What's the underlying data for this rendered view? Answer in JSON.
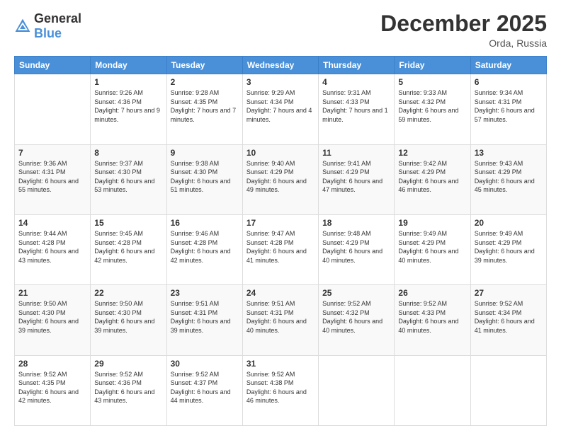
{
  "header": {
    "logo_general": "General",
    "logo_blue": "Blue",
    "month": "December 2025",
    "location": "Orda, Russia"
  },
  "weekdays": [
    "Sunday",
    "Monday",
    "Tuesday",
    "Wednesday",
    "Thursday",
    "Friday",
    "Saturday"
  ],
  "weeks": [
    [
      {
        "date": "",
        "sunrise": "",
        "sunset": "",
        "daylight": ""
      },
      {
        "date": "1",
        "sunrise": "9:26 AM",
        "sunset": "4:36 PM",
        "daylight": "7 hours and 9 minutes."
      },
      {
        "date": "2",
        "sunrise": "9:28 AM",
        "sunset": "4:35 PM",
        "daylight": "7 hours and 7 minutes."
      },
      {
        "date": "3",
        "sunrise": "9:29 AM",
        "sunset": "4:34 PM",
        "daylight": "7 hours and 4 minutes."
      },
      {
        "date": "4",
        "sunrise": "9:31 AM",
        "sunset": "4:33 PM",
        "daylight": "7 hours and 1 minute."
      },
      {
        "date": "5",
        "sunrise": "9:33 AM",
        "sunset": "4:32 PM",
        "daylight": "6 hours and 59 minutes."
      },
      {
        "date": "6",
        "sunrise": "9:34 AM",
        "sunset": "4:31 PM",
        "daylight": "6 hours and 57 minutes."
      }
    ],
    [
      {
        "date": "7",
        "sunrise": "9:36 AM",
        "sunset": "4:31 PM",
        "daylight": "6 hours and 55 minutes."
      },
      {
        "date": "8",
        "sunrise": "9:37 AM",
        "sunset": "4:30 PM",
        "daylight": "6 hours and 53 minutes."
      },
      {
        "date": "9",
        "sunrise": "9:38 AM",
        "sunset": "4:30 PM",
        "daylight": "6 hours and 51 minutes."
      },
      {
        "date": "10",
        "sunrise": "9:40 AM",
        "sunset": "4:29 PM",
        "daylight": "6 hours and 49 minutes."
      },
      {
        "date": "11",
        "sunrise": "9:41 AM",
        "sunset": "4:29 PM",
        "daylight": "6 hours and 47 minutes."
      },
      {
        "date": "12",
        "sunrise": "9:42 AM",
        "sunset": "4:29 PM",
        "daylight": "6 hours and 46 minutes."
      },
      {
        "date": "13",
        "sunrise": "9:43 AM",
        "sunset": "4:29 PM",
        "daylight": "6 hours and 45 minutes."
      }
    ],
    [
      {
        "date": "14",
        "sunrise": "9:44 AM",
        "sunset": "4:28 PM",
        "daylight": "6 hours and 43 minutes."
      },
      {
        "date": "15",
        "sunrise": "9:45 AM",
        "sunset": "4:28 PM",
        "daylight": "6 hours and 42 minutes."
      },
      {
        "date": "16",
        "sunrise": "9:46 AM",
        "sunset": "4:28 PM",
        "daylight": "6 hours and 42 minutes."
      },
      {
        "date": "17",
        "sunrise": "9:47 AM",
        "sunset": "4:28 PM",
        "daylight": "6 hours and 41 minutes."
      },
      {
        "date": "18",
        "sunrise": "9:48 AM",
        "sunset": "4:29 PM",
        "daylight": "6 hours and 40 minutes."
      },
      {
        "date": "19",
        "sunrise": "9:49 AM",
        "sunset": "4:29 PM",
        "daylight": "6 hours and 40 minutes."
      },
      {
        "date": "20",
        "sunrise": "9:49 AM",
        "sunset": "4:29 PM",
        "daylight": "6 hours and 39 minutes."
      }
    ],
    [
      {
        "date": "21",
        "sunrise": "9:50 AM",
        "sunset": "4:30 PM",
        "daylight": "6 hours and 39 minutes."
      },
      {
        "date": "22",
        "sunrise": "9:50 AM",
        "sunset": "4:30 PM",
        "daylight": "6 hours and 39 minutes."
      },
      {
        "date": "23",
        "sunrise": "9:51 AM",
        "sunset": "4:31 PM",
        "daylight": "6 hours and 39 minutes."
      },
      {
        "date": "24",
        "sunrise": "9:51 AM",
        "sunset": "4:31 PM",
        "daylight": "6 hours and 40 minutes."
      },
      {
        "date": "25",
        "sunrise": "9:52 AM",
        "sunset": "4:32 PM",
        "daylight": "6 hours and 40 minutes."
      },
      {
        "date": "26",
        "sunrise": "9:52 AM",
        "sunset": "4:33 PM",
        "daylight": "6 hours and 40 minutes."
      },
      {
        "date": "27",
        "sunrise": "9:52 AM",
        "sunset": "4:34 PM",
        "daylight": "6 hours and 41 minutes."
      }
    ],
    [
      {
        "date": "28",
        "sunrise": "9:52 AM",
        "sunset": "4:35 PM",
        "daylight": "6 hours and 42 minutes."
      },
      {
        "date": "29",
        "sunrise": "9:52 AM",
        "sunset": "4:36 PM",
        "daylight": "6 hours and 43 minutes."
      },
      {
        "date": "30",
        "sunrise": "9:52 AM",
        "sunset": "4:37 PM",
        "daylight": "6 hours and 44 minutes."
      },
      {
        "date": "31",
        "sunrise": "9:52 AM",
        "sunset": "4:38 PM",
        "daylight": "6 hours and 46 minutes."
      },
      {
        "date": "",
        "sunrise": "",
        "sunset": "",
        "daylight": ""
      },
      {
        "date": "",
        "sunrise": "",
        "sunset": "",
        "daylight": ""
      },
      {
        "date": "",
        "sunrise": "",
        "sunset": "",
        "daylight": ""
      }
    ]
  ],
  "labels": {
    "sunrise_prefix": "Sunrise: ",
    "sunset_prefix": "Sunset: ",
    "daylight_prefix": "Daylight: "
  }
}
